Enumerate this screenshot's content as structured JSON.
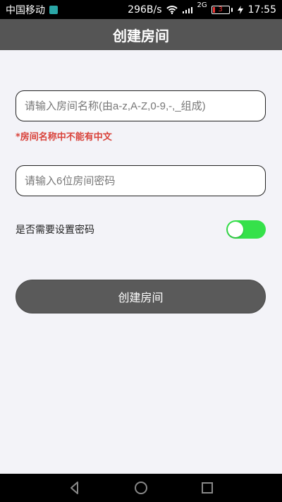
{
  "status_bar": {
    "carrier": "中国移动",
    "network_speed": "296B/s",
    "network_type": "2G",
    "battery_level": "3",
    "time": "17:55",
    "icons": {
      "wifi": "wifi-icon",
      "signal": "signal-icon",
      "charging": "charging-icon"
    }
  },
  "app_bar": {
    "title": "创建房间"
  },
  "form": {
    "room_name_placeholder": "请输入房间名称(由a-z,A-Z,0-9,-,_组成)",
    "room_name_error": "*房间名称中不能有中文",
    "room_password_placeholder": "请输入6位房间密码",
    "need_password_label": "是否需要设置密码",
    "need_password_toggle_on": true,
    "submit_label": "创建房间"
  },
  "colors": {
    "app_bar_bg": "#555555",
    "error": "#d9423a",
    "toggle_on": "#35e14a",
    "button_bg": "#5a5a5a",
    "page_bg": "#f3f3f8"
  },
  "navigation_bar": {
    "icons": [
      "back-icon",
      "home-icon",
      "recents-icon"
    ]
  }
}
